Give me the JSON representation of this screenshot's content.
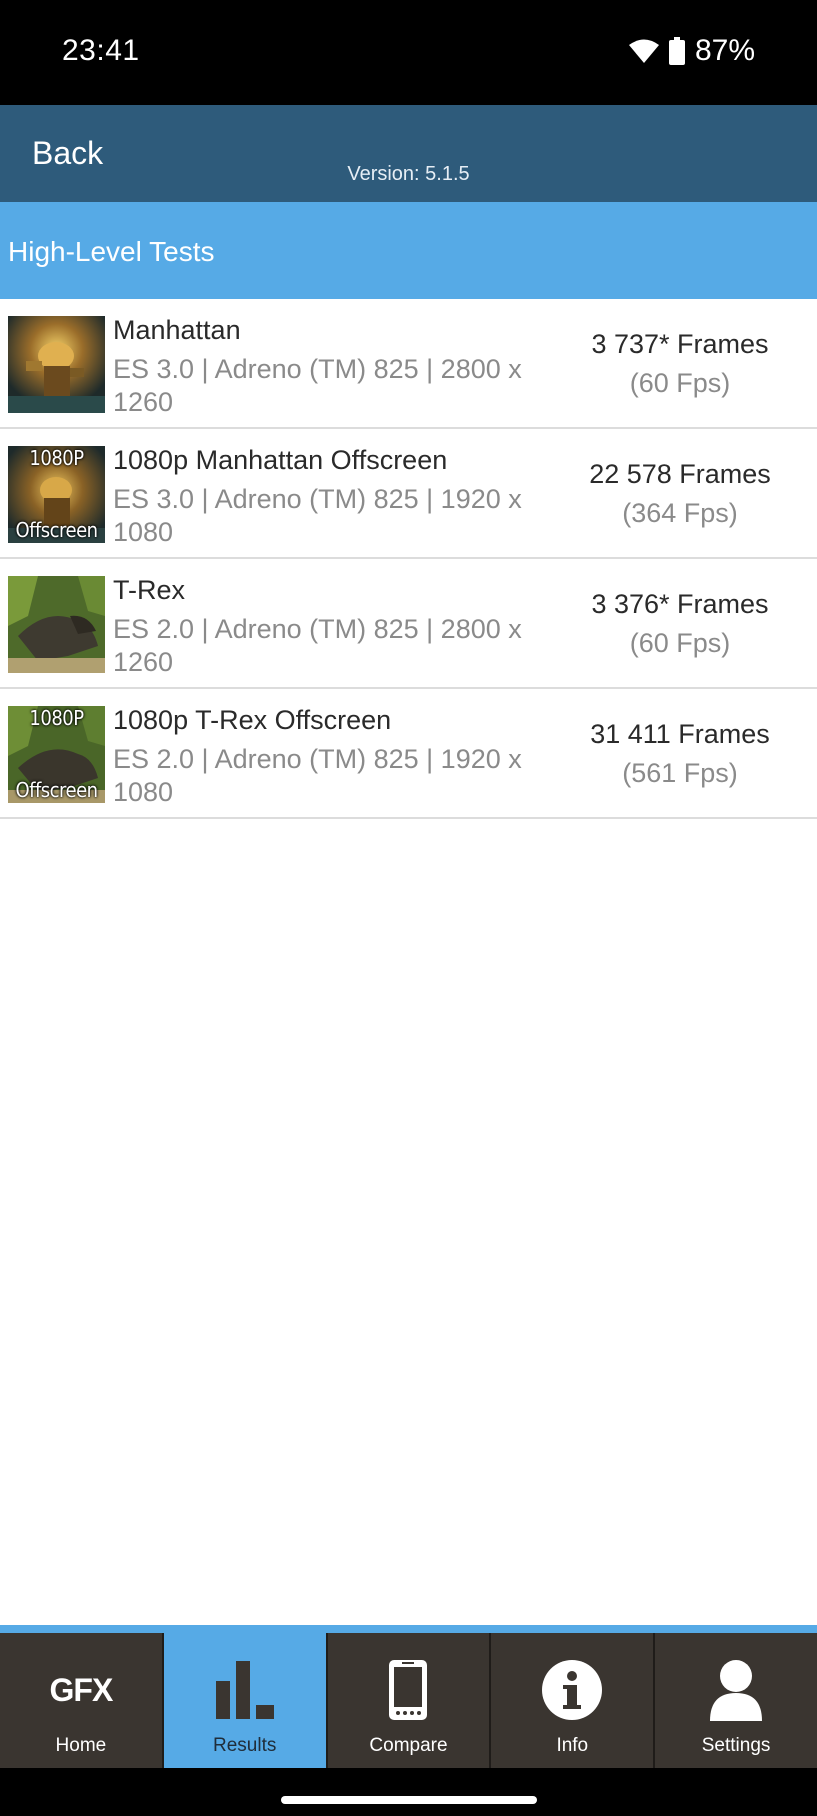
{
  "status_bar": {
    "time": "23:41",
    "battery_text": "87%",
    "icons": [
      "wifi-icon",
      "battery-icon"
    ]
  },
  "header": {
    "back_label": "Back",
    "version": "Version: 5.1.5",
    "background_color": "#2e5b7b"
  },
  "section": {
    "title": "High-Level Tests",
    "background_color": "#56aae6"
  },
  "tests": [
    {
      "thumb_label_top": "",
      "thumb_label_bottom": "",
      "thumb_scene": "robot",
      "name": "Manhattan",
      "details": "ES 3.0 | Adreno (TM) 825 | 2800 x 1260",
      "frames": "3 737* Frames",
      "fps": "(60 Fps)"
    },
    {
      "thumb_label_top": "1080P",
      "thumb_label_bottom": "Offscreen",
      "thumb_scene": "robot",
      "name": "1080p Manhattan Offscreen",
      "details": "ES 3.0 | Adreno (TM) 825 | 1920 x 1080",
      "frames": "22 578 Frames",
      "fps": "(364 Fps)"
    },
    {
      "thumb_label_top": "",
      "thumb_label_bottom": "",
      "thumb_scene": "dino",
      "name": "T-Rex",
      "details": "ES 2.0 | Adreno (TM) 825 | 2800 x 1260",
      "frames": "3 376* Frames",
      "fps": "(60 Fps)"
    },
    {
      "thumb_label_top": "1080P",
      "thumb_label_bottom": "Offscreen",
      "thumb_scene": "dino",
      "name": "1080p T-Rex Offscreen",
      "details": "ES 2.0 | Adreno (TM) 825 | 1920 x 1080",
      "frames": "31 411 Frames",
      "fps": "(561 Fps)"
    }
  ],
  "nav": {
    "active": "results",
    "items": [
      {
        "id": "home",
        "label": "Home",
        "icon": "gfx-logo",
        "logo_text": "GFX"
      },
      {
        "id": "results",
        "label": "Results",
        "icon": "bar-chart-icon"
      },
      {
        "id": "compare",
        "label": "Compare",
        "icon": "phone-icon"
      },
      {
        "id": "info",
        "label": "Info",
        "icon": "info-icon"
      },
      {
        "id": "settings",
        "label": "Settings",
        "icon": "person-icon"
      }
    ]
  }
}
